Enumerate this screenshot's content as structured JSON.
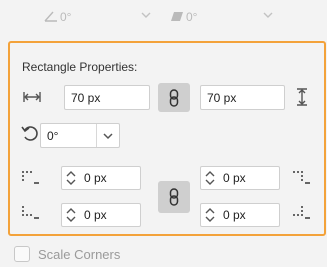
{
  "top_row": {
    "skew_angle_value": "0°",
    "shear_value": "0°"
  },
  "rectangle_properties": {
    "title": "Rectangle Properties:",
    "width_value": "70 px",
    "height_value": "70 px",
    "rotation_value": "0°",
    "corner_top_left": "0 px",
    "corner_top_right": "0 px",
    "corner_bottom_left": "0 px",
    "corner_bottom_right": "0 px"
  },
  "scale_corners": {
    "label": "Scale Corners",
    "checked": false
  },
  "colors": {
    "highlight_border": "#f3a23a",
    "link_button_bg": "#cfcfcf"
  }
}
